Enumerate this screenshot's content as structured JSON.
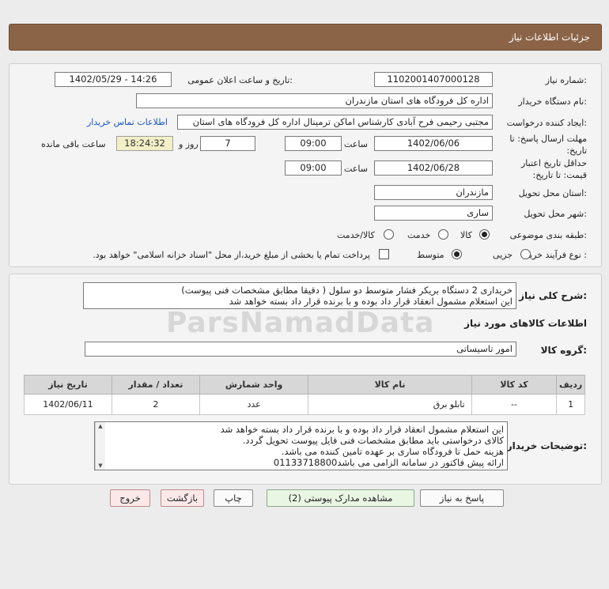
{
  "header": {
    "title": "جزئیات اطلاعات نیاز"
  },
  "info": {
    "need_number_label": "شماره نیاز:",
    "need_number": "1102001407000128",
    "announce_label": "تاریخ و ساعت اعلان عمومی:",
    "announce_value": "1402/05/29 - 14:26",
    "buyer_org_label": "نام دستگاه خریدار:",
    "buyer_org": "اداره کل فرودگاه های استان مازندران",
    "creator_label": "ایجاد کننده درخواست:",
    "creator": "مجتبی رحیمی فرح آبادی کارشناس اماکن ترمینال اداره کل فرودگاه های استان",
    "contact_link": "اطلاعات تماس خریدار",
    "reply_deadline_label": "مهلت ارسال پاسخ: تا تاریخ:",
    "reply_date": "1402/06/06",
    "time_label": "ساعت",
    "reply_time": "09:00",
    "days_value": "7",
    "days_label": "روز و",
    "remaining_time": "18:24:32",
    "remaining_label": "ساعت باقی مانده",
    "price_validity_label": "حداقل تاریخ اعتبار قیمت: تا تاریخ:",
    "price_date": "1402/06/28",
    "price_time": "09:00",
    "province_label": "استان محل تحویل:",
    "province": "مازندران",
    "city_label": "شهر محل تحویل:",
    "city": "ساری",
    "category_label": "طبقه بندی موضوعی:",
    "category_options": [
      "کالا",
      "خدمت",
      "کالا/خدمت"
    ],
    "process_label": "نوع فرآیند خرید :",
    "process_options": [
      "جزیی",
      "متوسط"
    ],
    "payment_note": "پرداخت تمام یا بخشی از مبلغ خرید،از محل \"اسناد خزانه اسلامی\" خواهد بود."
  },
  "need": {
    "summary_label": "شرح کلی نیاز:",
    "summary_lines": [
      "خریداری 2 دستگاه بریکر فشار متوسط دو سلول ( دقیقا مطابق مشخصات فنی پیوست)",
      "این استعلام مشمول انعقاد قرار داد بوده و با برنده قرار داد بسته خواهد شد"
    ],
    "goods_info_title": "اطلاعات کالاهای مورد نیاز",
    "group_label": "گروه کالا:",
    "group_value": "امور تاسیساتی"
  },
  "table": {
    "headers": [
      "ردیف",
      "کد کالا",
      "نام کالا",
      "واحد شمارش",
      "تعداد / مقدار",
      "تاریخ نیاز"
    ],
    "rows": [
      [
        "1",
        "--",
        "تابلو برق",
        "عدد",
        "2",
        "1402/06/11"
      ]
    ]
  },
  "buyer_notes": {
    "label": "توضیحات خریدار:",
    "lines": [
      "این استعلام مشمول انعقاد قرار داد بوده و با برنده قرار داد بسته خواهد شد",
      "کالای درخواستی باید مطابق مشخصات فنی فایل پیوست تحویل گردد.",
      "هزینه حمل تا فرودگاه ساری بر عهده تامین کننده می باشد.",
      "ارائه پیش فاکتور در سامانه الزامی می باشد01133718800"
    ]
  },
  "buttons": {
    "reply": "پاسخ به نیاز",
    "attachments": "مشاهده مدارک پیوستی (2)",
    "print": "چاپ",
    "back": "بازگشت",
    "exit": "خروج"
  },
  "watermark": "ParsNamadData"
}
